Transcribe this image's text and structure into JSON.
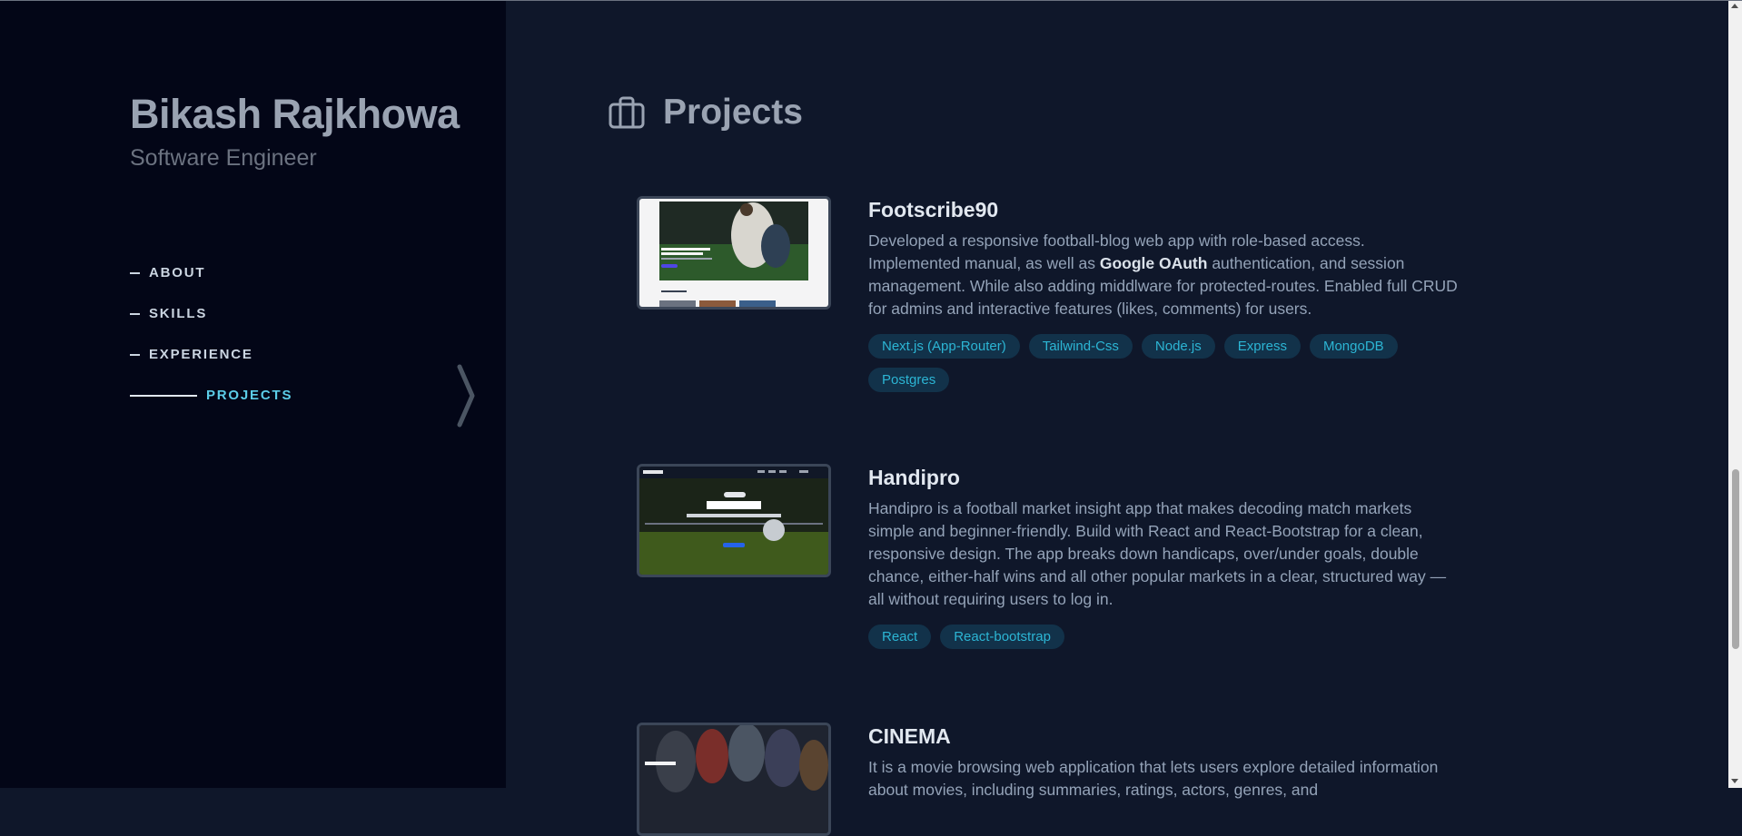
{
  "profile": {
    "name": "Bikash Rajkhowa",
    "role": "Software Engineer"
  },
  "nav": {
    "items": [
      {
        "label": "ABOUT",
        "active": false
      },
      {
        "label": "SKILLS",
        "active": false
      },
      {
        "label": "EXPERIENCE",
        "active": false
      },
      {
        "label": "PROJECTS",
        "active": true
      }
    ]
  },
  "section": {
    "title": "Projects",
    "icon": "briefcase-icon"
  },
  "projects": [
    {
      "title": "Footscribe90",
      "description_parts": [
        "Developed a responsive football-blog web app with role-based access. Implemented manual, as well as ",
        "Google OAuth",
        " authentication, and session management. While also adding middlware for protected-routes. Enabled full CRUD for admins and interactive features (likes, comments) for users."
      ],
      "tags": [
        "Next.js (App-Router)",
        "Tailwind-Css",
        "Node.js",
        "Express",
        "MongoDB",
        "Postgres"
      ],
      "thumbnail": {
        "headline": "Kylian Mbappe Is Disc Debut A New Era for Real Madrid",
        "section": "Featured Posts"
      }
    },
    {
      "title": "Handipro",
      "description": "Handipro is a football market insight app that makes decoding match markets simple and beginner-friendly. Build with React and React-Bootstrap for a clean, responsive design. The app breaks down handicaps, over/under goals, double chance, either-half wins and all other popular markets in a clear, structured way — all without requiring users to log in.",
      "tags": [
        "React",
        "React-bootstrap"
      ],
      "thumbnail": {
        "logo": "andipro",
        "title": "Handipro",
        "tagline": "software for football clarity and insight"
      }
    },
    {
      "title": "CINEMA",
      "description": "It is a movie browsing web application that lets users explore detailed information about movies, including summaries, ratings, actors, genres, and",
      "tags": [],
      "thumbnail": {
        "title": "The Avengers"
      }
    }
  ],
  "colors": {
    "accent": "#5ccde8",
    "tag_text": "#2cb5d4",
    "tag_bg": "#12324a",
    "sidebar_bg": "#030617",
    "main_bg": "#0f172a"
  }
}
